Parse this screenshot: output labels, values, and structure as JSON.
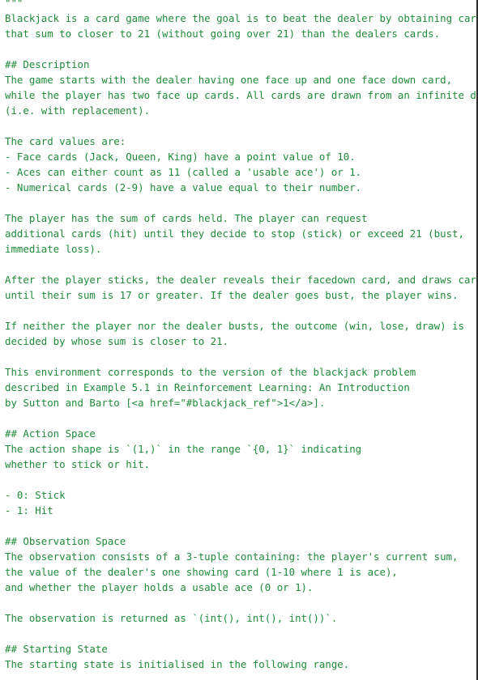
{
  "document": {
    "lines": [
      "\"\"\"",
      "Blackjack is a card game where the goal is to beat the dealer by obtaining cards",
      "that sum to closer to 21 (without going over 21) than the dealers cards.",
      "",
      "## Description",
      "The game starts with the dealer having one face up and one face down card,",
      "while the player has two face up cards. All cards are drawn from an infinite deck",
      "(i.e. with replacement).",
      "",
      "The card values are:",
      "- Face cards (Jack, Queen, King) have a point value of 10.",
      "- Aces can either count as 11 (called a 'usable ace') or 1.",
      "- Numerical cards (2-9) have a value equal to their number.",
      "",
      "The player has the sum of cards held. The player can request",
      "additional cards (hit) until they decide to stop (stick) or exceed 21 (bust,",
      "immediate loss).",
      "",
      "After the player sticks, the dealer reveals their facedown card, and draws cards",
      "until their sum is 17 or greater. If the dealer goes bust, the player wins.",
      "",
      "If neither the player nor the dealer busts, the outcome (win, lose, draw) is",
      "decided by whose sum is closer to 21.",
      "",
      "This environment corresponds to the version of the blackjack problem",
      "described in Example 5.1 in Reinforcement Learning: An Introduction",
      "by Sutton and Barto [<a href=\"#blackjack_ref\">1</a>].",
      "",
      "## Action Space",
      "The action shape is `(1,)` in the range `{0, 1}` indicating",
      "whether to stick or hit.",
      "",
      "- 0: Stick",
      "- 1: Hit",
      "",
      "## Observation Space",
      "The observation consists of a 3-tuple containing: the player's current sum,",
      "the value of the dealer's one showing card (1-10 where 1 is ace),",
      "and whether the player holds a usable ace (0 or 1).",
      "",
      "The observation is returned as `(int(), int(), int())`.",
      "",
      "## Starting State",
      "The starting state is initialised in the following range."
    ]
  },
  "colors": {
    "text": "#1f8a3a",
    "background": "#ffffff",
    "border": "#2b2b2b"
  }
}
